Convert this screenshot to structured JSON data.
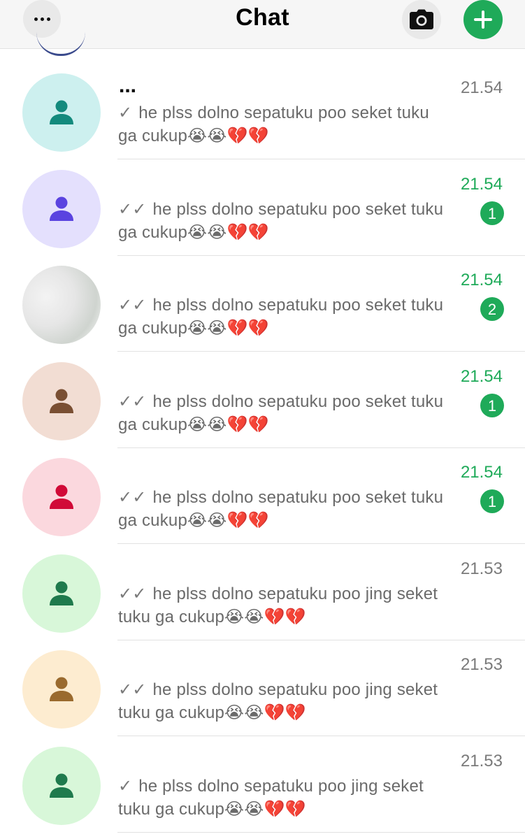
{
  "header": {
    "title": "Chat",
    "more_icon": "more-horizontal-icon",
    "camera_icon": "camera-icon",
    "new_chat_icon": "plus-icon",
    "accent_color": "#1faa59"
  },
  "chats": [
    {
      "name": "...",
      "tick": "✓",
      "message": "he plss dolno sepatuku poo seket tuku ga cukup😭😭💔💔",
      "time": "21.54",
      "unread": "",
      "avatar_bg": "#cdf0ef",
      "avatar_fg": "#138a7d",
      "photo": false
    },
    {
      "name": "",
      "tick": "✓✓",
      "message": "he plss dolno sepatuku poo seket tuku ga cukup😭😭💔💔",
      "time": "21.54",
      "unread": "1",
      "avatar_bg": "#e4e0fd",
      "avatar_fg": "#5a43e0",
      "photo": false
    },
    {
      "name": "",
      "tick": "✓✓",
      "message": "he plss dolno sepatuku poo seket tuku ga cukup😭😭💔💔",
      "time": "21.54",
      "unread": "2",
      "avatar_bg": "#ececec",
      "avatar_fg": "#ececec",
      "photo": true
    },
    {
      "name": "",
      "tick": "✓✓",
      "message": "he plss dolno sepatuku poo seket tuku ga cukup😭😭💔💔",
      "time": "21.54",
      "unread": "1",
      "avatar_bg": "#f2ddd3",
      "avatar_fg": "#7a4f33",
      "photo": false
    },
    {
      "name": "",
      "tick": "✓✓",
      "message": "he plss dolno sepatuku poo seket tuku ga cukup😭😭💔💔",
      "time": "21.54",
      "unread": "1",
      "avatar_bg": "#fbd8de",
      "avatar_fg": "#d10a37",
      "photo": false
    },
    {
      "name": "",
      "tick": "✓✓",
      "message": "he plss dolno sepatuku poo jing seket tuku ga cukup😭😭💔💔",
      "time": "21.53",
      "unread": "",
      "avatar_bg": "#d8f7d9",
      "avatar_fg": "#1f7a4d",
      "photo": false
    },
    {
      "name": "",
      "tick": "✓✓",
      "message": "he plss dolno sepatuku poo jing seket tuku ga cukup😭😭💔💔",
      "time": "21.53",
      "unread": "",
      "avatar_bg": "#fdecd0",
      "avatar_fg": "#9a6a2e",
      "photo": false
    },
    {
      "name": "",
      "tick": "✓",
      "message": "he plss dolno sepatuku poo jing seket tuku ga cukup😭😭💔💔",
      "time": "21.53",
      "unread": "",
      "avatar_bg": "#d8f7d9",
      "avatar_fg": "#1f7a4d",
      "photo": false
    }
  ]
}
